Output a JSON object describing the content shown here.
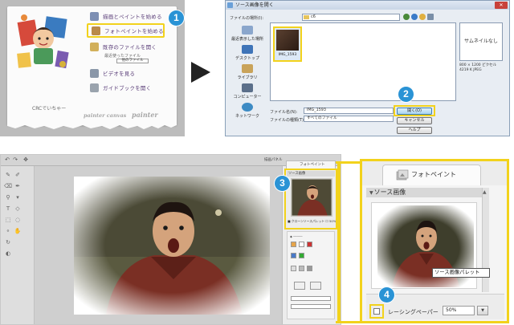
{
  "launcher": {
    "items": [
      {
        "label": "描画とペイントを始める"
      },
      {
        "label": "フォトペイントを始める"
      },
      {
        "label": "既存のファイルを開く"
      },
      {
        "label": "ビデオを見る"
      },
      {
        "label": "ガイドブックを開く"
      }
    ],
    "sub_label": "最近使ったファイル",
    "sub_button": "他のファイル",
    "footer_brand": "CRCでいちゃー",
    "logos": [
      "painter canvas",
      "painter"
    ]
  },
  "dialog": {
    "title": "ソース画像を開く",
    "look_in_label": "ファイルの場所(I):",
    "look_in_value": "c6",
    "sidebar": [
      "最近表示した場所",
      "デスクトップ",
      "ライブラリ",
      "コンピューター",
      "ネットワーク"
    ],
    "file_name": "IMG_1593",
    "preview_text": "サムネイルなし",
    "info_lines": [
      "800 × 1200 ピクセル",
      "4219 K  JPEG"
    ],
    "filename_label": "ファイル名(N):",
    "filename_value": "IMG_1593",
    "filetype_label": "ファイルの種類(T):",
    "filetype_value": "すべてのファイル",
    "open_button": "開く(O)",
    "cancel_button": "キャンセル",
    "help_button": "ヘルプ"
  },
  "editor": {
    "palette_tab": "フォトペイント",
    "source_header": "ソース画像",
    "source_checkbox": "■ クローンソースパレット  ☐ 50%",
    "top_label": "描画パネル"
  },
  "zoom": {
    "tab_label": "フォトペイント",
    "section_header": "ソース画像",
    "tooltip": "ソース画像パレット",
    "tracing_label": "レーシングペーパー",
    "tracing_value": "50%"
  },
  "badges": [
    "1",
    "2",
    "3",
    "4"
  ],
  "colors": {
    "highlight": "#f2d21c",
    "badge": "#2a93d5"
  }
}
